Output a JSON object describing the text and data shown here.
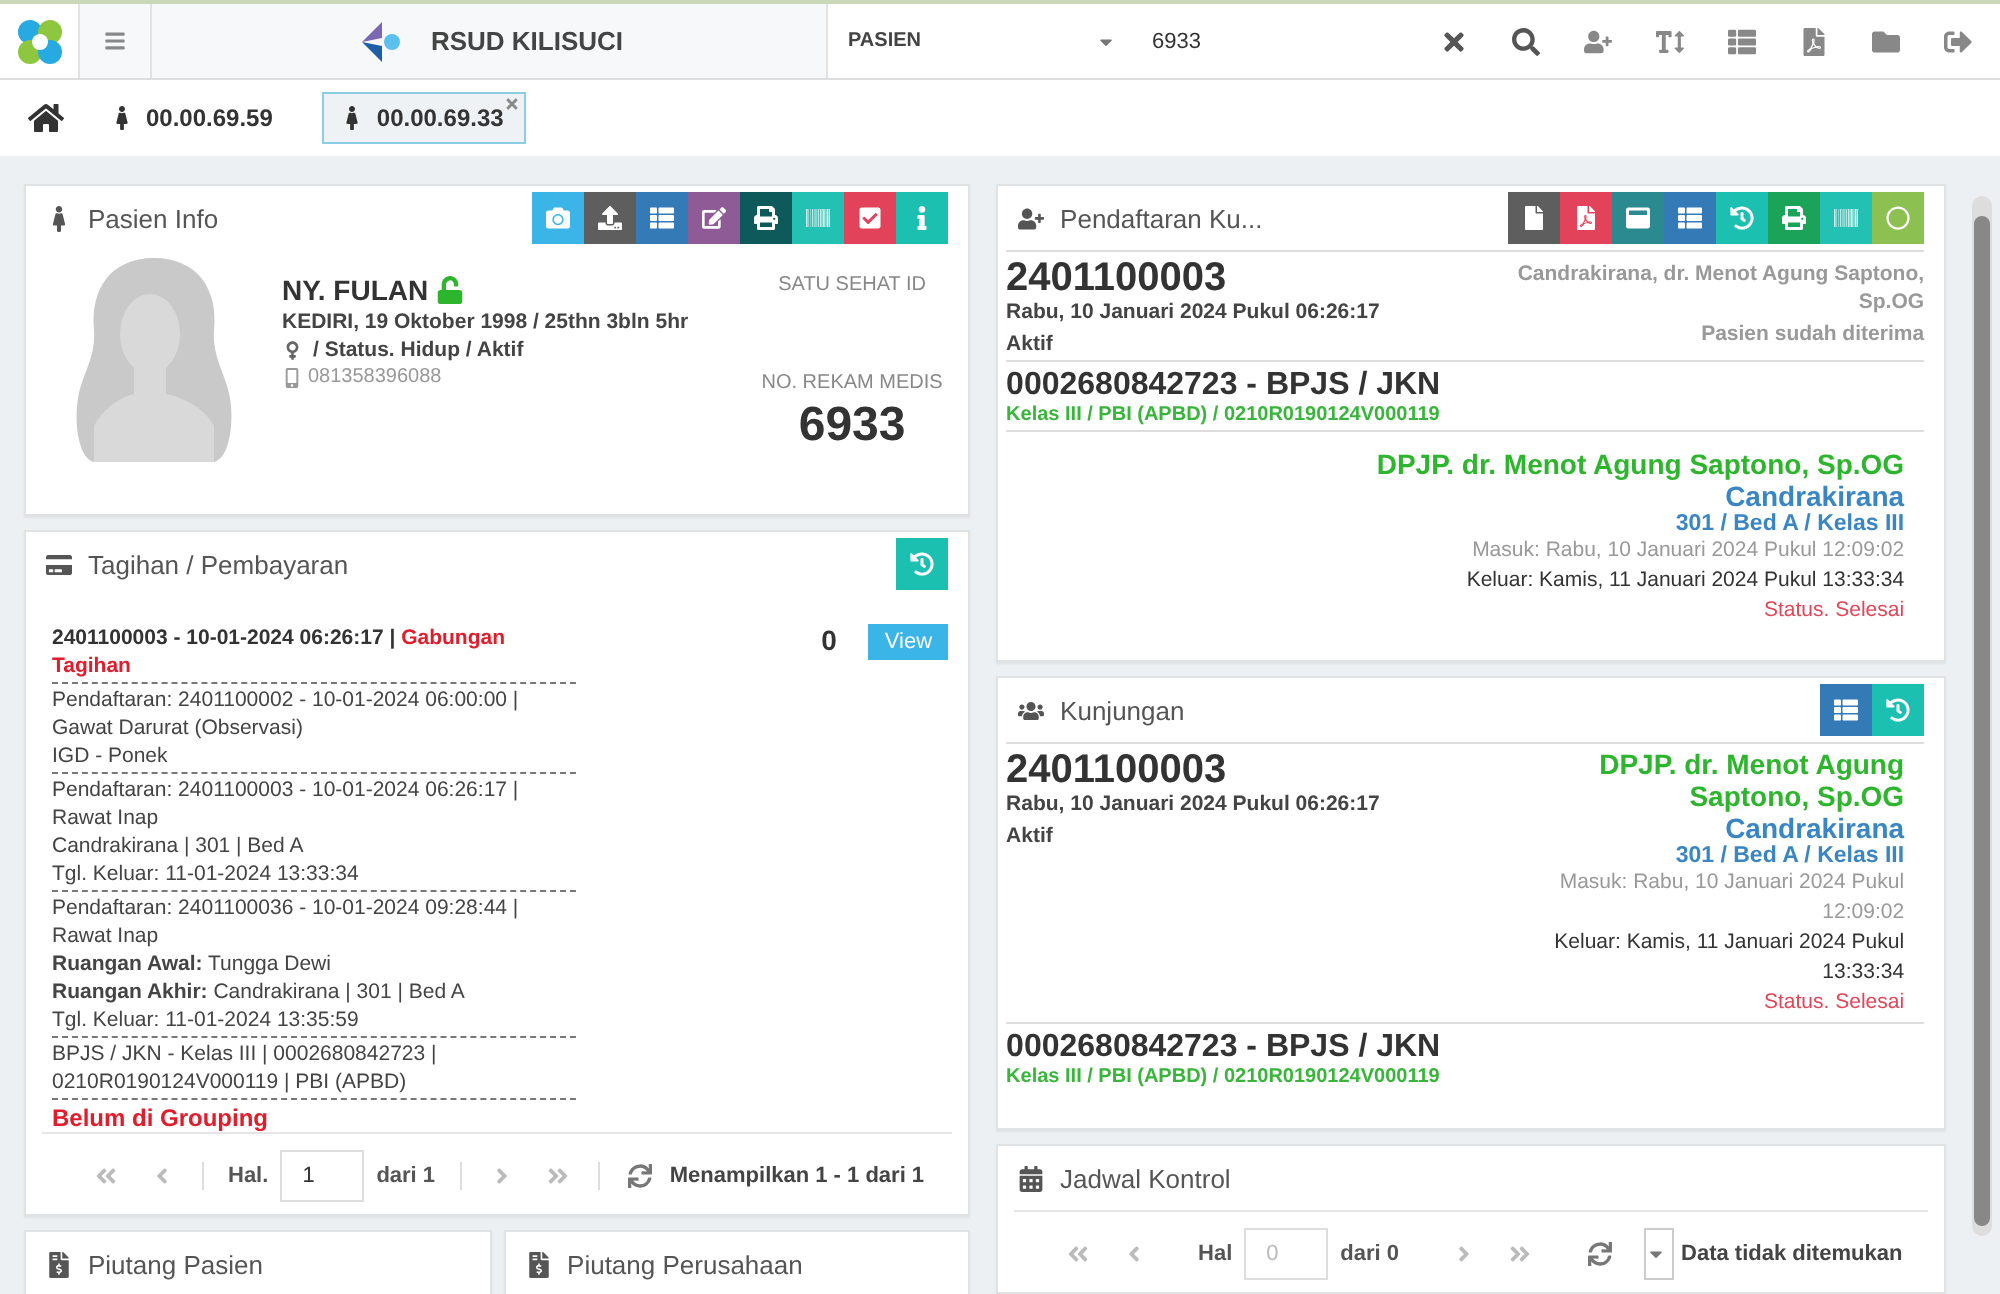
{
  "topbar": {
    "title": "RSUD KILISUCI",
    "search_category": "PASIEN",
    "search_value": "6933"
  },
  "tabs": [
    {
      "label": "00.00.69.59",
      "selected": false
    },
    {
      "label": "00.00.69.33",
      "selected": true
    }
  ],
  "patient_info": {
    "title": "Pasien Info",
    "buttons": [
      {
        "kind": "camera",
        "color": "#3bb5e8"
      },
      {
        "kind": "upload",
        "color": "#5e5e5e"
      },
      {
        "kind": "list",
        "color": "#337ab7"
      },
      {
        "kind": "edit",
        "color": "#8e5b96"
      },
      {
        "kind": "print",
        "color": "#0e5a5a"
      },
      {
        "kind": "barcode",
        "color": "#22c1b4"
      },
      {
        "kind": "check",
        "color": "#e2435a"
      },
      {
        "kind": "info",
        "color": "#1cc0b0"
      }
    ],
    "name": "NY. FULAN",
    "locked": false,
    "birth": "KEDIRI, 19 Oktober 1998 / 25thn 3bln 5hr",
    "status": "/ Status. Hidup / Aktif",
    "phone": "081358396088",
    "satu_sehat_label": "SATU SEHAT ID",
    "rm_label": "NO. REKAM MEDIS",
    "rm_number": "6933"
  },
  "billing": {
    "title": "Tagihan / Pembayaran",
    "header_id": "2401100003 - 10-01-2024 06:26:17 | ",
    "header_tag": "Gabungan Tagihan",
    "amount": "0",
    "view_button": "View",
    "groups": [
      [
        "Pendaftaran: 2401100002 - 10-01-2024 06:00:00 |",
        "Gawat Darurat (Observasi)",
        "IGD - Ponek"
      ],
      [
        "Pendaftaran: 2401100003 - 10-01-2024 06:26:17 |",
        "Rawat Inap",
        "Candrakirana | 301 | Bed A",
        "Tgl. Keluar: 11-01-2024 13:33:34"
      ],
      [
        "Pendaftaran: 2401100036 - 10-01-2024 09:28:44 |",
        "Rawat Inap",
        "**Ruangan Awal:** Tungga Dewi",
        "**Ruangan Akhir:** Candrakirana | 301 | Bed A",
        "Tgl. Keluar: 11-01-2024 13:35:59"
      ],
      [
        "BPJS / JKN - Kelas III | 0002680842723 |",
        "0210R0190124V000119 | PBI (APBD)"
      ]
    ],
    "grouping_status": "Belum di Grouping",
    "pager": {
      "label": "Hal.",
      "page": {
        "value": "1"
      },
      "of": "dari 1",
      "summary": "Menampilkan 1 - 1 dari 1"
    }
  },
  "receivables": [
    "Piutang Pasien",
    "Piutang Perusahaan"
  ],
  "registration": {
    "title": "Pendaftaran Ku...",
    "buttons": [
      {
        "kind": "file",
        "color": "#5e5e5e"
      },
      {
        "kind": "pdf",
        "color": "#e2435a"
      },
      {
        "kind": "card",
        "color": "#2b8a8f"
      },
      {
        "kind": "list",
        "color": "#337ab7"
      },
      {
        "kind": "history",
        "color": "#1cc0b0"
      },
      {
        "kind": "print",
        "color": "#1ba35a"
      },
      {
        "kind": "barcode",
        "color": "#22c1b4"
      },
      {
        "kind": "circle",
        "color": "#8cc152"
      }
    ],
    "number": "2401100003",
    "date": "Rabu, 10 Januari 2024 Pukul 06:26:17",
    "state": "Aktif",
    "unit_doctor": "Candrakirana, dr. Menot Agung Saptono, Sp.OG",
    "note": "Pasien sudah diterima",
    "insurance": "0002680842723 - BPJS / JKN",
    "insurance_detail": "Kelas III / PBI (APBD) / 0210R0190124V000119",
    "dpjp": "DPJP. dr. Menot Agung Saptono, Sp.OG",
    "room": "Candrakirana",
    "bed": "301 / Bed A / Kelas III",
    "masuk": "Masuk: Rabu, 10 Januari 2024 Pukul 12:09:02",
    "keluar": "Keluar: Kamis, 11 Januari 2024 Pukul 13:33:34",
    "result": "Status. Selesai"
  },
  "visit": {
    "title": "Kunjungan",
    "buttons": [
      {
        "kind": "list",
        "color": "#337ab7"
      },
      {
        "kind": "history",
        "color": "#1cc0b0"
      }
    ],
    "number": "2401100003",
    "date": "Rabu, 10 Januari 2024 Pukul 06:26:17",
    "state": "Aktif",
    "dpjp": "DPJP. dr. Menot Agung Saptono, Sp.OG",
    "room": "Candrakirana",
    "bed": "301 / Bed A / Kelas III",
    "masuk": "Masuk: Rabu, 10 Januari 2024 Pukul 12:09:02",
    "keluar": "Keluar: Kamis, 11 Januari 2024 Pukul 13:33:34",
    "result": "Status. Selesai",
    "insurance": "0002680842723 - BPJS / JKN",
    "insurance_detail": "Kelas III / PBI (APBD) / 0210R0190124V000119"
  },
  "control_schedule": {
    "title": "Jadwal Kontrol",
    "pager": {
      "label": "Hal",
      "page": {
        "placeholder": "0"
      },
      "of": "dari 0",
      "size_select": true,
      "summary": "Data tidak ditemukan"
    }
  }
}
